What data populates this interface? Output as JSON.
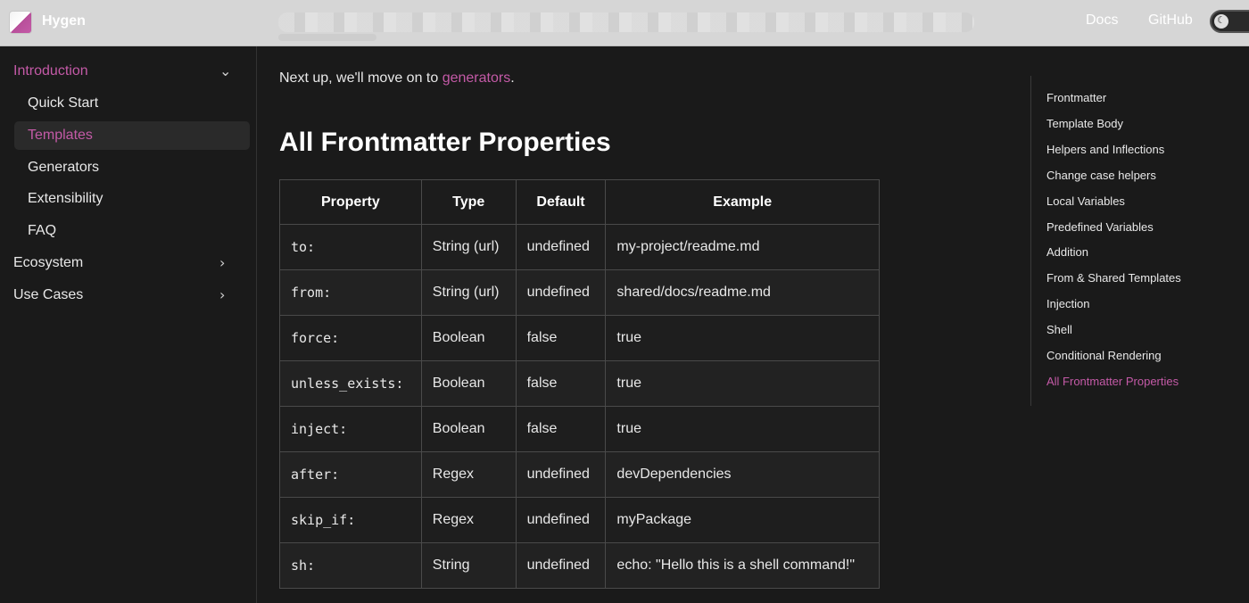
{
  "header": {
    "brand": "Hygen",
    "nav": {
      "docs": "Docs",
      "github": "GitHub"
    },
    "theme_toggle_icon": "moon-icon"
  },
  "sidebar": {
    "items": [
      {
        "label": "Introduction",
        "active_section": true,
        "expanded": true
      },
      {
        "label": "Quick Start"
      },
      {
        "label": "Templates",
        "selected": true
      },
      {
        "label": "Generators"
      },
      {
        "label": "Extensibility"
      },
      {
        "label": "FAQ"
      },
      {
        "label": "Ecosystem",
        "expanded": false
      },
      {
        "label": "Use Cases",
        "expanded": false
      }
    ]
  },
  "main": {
    "intro_prefix": "Next up, we'll move on to ",
    "intro_link": "generators",
    "intro_suffix": ".",
    "title": "All Frontmatter Properties",
    "table": {
      "headers": [
        "Property",
        "Type",
        "Default",
        "Example"
      ],
      "rows": [
        [
          "to:",
          "String (url)",
          "undefined",
          "my-project/readme.md"
        ],
        [
          "from:",
          "String (url)",
          "undefined",
          "shared/docs/readme.md"
        ],
        [
          "force:",
          "Boolean",
          "false",
          "true"
        ],
        [
          "unless_exists:",
          "Boolean",
          "false",
          "true"
        ],
        [
          "inject:",
          "Boolean",
          "false",
          "true"
        ],
        [
          "after:",
          "Regex",
          "undefined",
          "devDependencies"
        ],
        [
          "skip_if:",
          "Regex",
          "undefined",
          "myPackage"
        ],
        [
          "sh:",
          "String",
          "undefined",
          "echo: \"Hello this is a shell command!\""
        ]
      ]
    }
  },
  "toc": {
    "items": [
      "Frontmatter",
      "Template Body",
      "Helpers and Inflections",
      "Change case helpers",
      "Local Variables",
      "Predefined Variables",
      "Addition",
      "From & Shared Templates",
      "Injection",
      "Shell",
      "Conditional Rendering",
      "All Frontmatter Properties"
    ]
  },
  "colors": {
    "accent": "#c45aa7",
    "background": "#1a1a1a",
    "header_bg": "#d6d6d6"
  }
}
